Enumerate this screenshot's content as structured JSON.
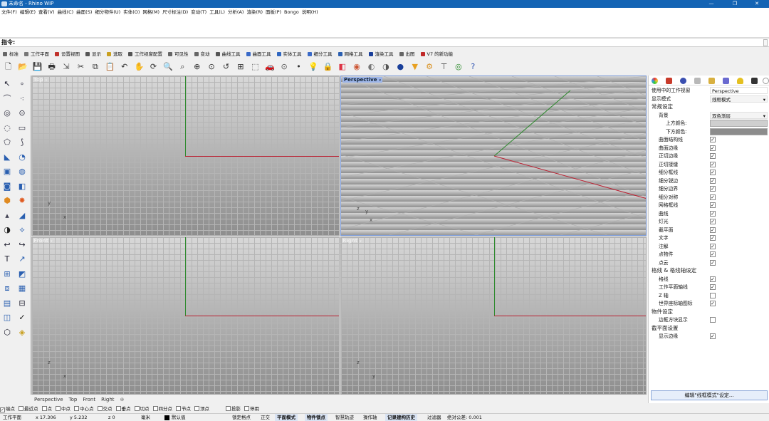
{
  "window": {
    "title": "未命名 - Rhino WIP"
  },
  "menu": [
    "文件(F)",
    "编辑(E)",
    "查看(V)",
    "曲线(C)",
    "曲面(S)",
    "细分物件(U)",
    "实体(O)",
    "网格(M)",
    "尺寸标注(D)",
    "变动(T)",
    "工具(L)",
    "分析(A)",
    "渲染(R)",
    "面板(P)",
    "Bongo",
    "说明(H)"
  ],
  "command": {
    "label": "指令:"
  },
  "tabs": [
    {
      "label": "标准",
      "color": "#666"
    },
    {
      "label": "工作平面",
      "color": "#777"
    },
    {
      "label": "设置视图",
      "color": "#c0302a"
    },
    {
      "label": "显示",
      "color": "#555"
    },
    {
      "label": "选取",
      "color": "#c9a020"
    },
    {
      "label": "工作视窗配置",
      "color": "#555"
    },
    {
      "label": "可见性",
      "color": "#666"
    },
    {
      "label": "变动",
      "color": "#666"
    },
    {
      "label": "曲线工具",
      "color": "#555"
    },
    {
      "label": "曲面工具",
      "color": "#3a6ac8"
    },
    {
      "label": "实体工具",
      "color": "#2f66c0"
    },
    {
      "label": "细分工具",
      "color": "#3a6ac8"
    },
    {
      "label": "网格工具",
      "color": "#2b5fb0"
    },
    {
      "label": "渲染工具",
      "color": "#1a3f9a"
    },
    {
      "label": "出图",
      "color": "#666"
    },
    {
      "label": "V7 的新功能",
      "color": "#c02828"
    }
  ],
  "toolbar_icons": [
    "new-file-icon",
    "open-folder-icon",
    "save-icon",
    "print-icon",
    "import-icon",
    "cut-icon",
    "copy-icon",
    "paste-icon",
    "undo-icon",
    "pan-hand-icon",
    "rotate-view-icon",
    "zoom-icon",
    "zoom-window-icon",
    "zoom-extents-icon",
    "zoom-selected-icon",
    "undo-view-icon",
    "four-viewports-icon",
    "select-icon",
    "car-render-icon",
    "osnap-icon",
    "point-icon",
    "light-bulb-icon",
    "lock-icon",
    "material-icon",
    "color-wheel-icon",
    "shaded-sphere-icon",
    "rendered-sphere-icon",
    "blue-sphere-icon",
    "filter-icon",
    "settings-gear-icon",
    "tree-icon",
    "globe-icon",
    "help-icon"
  ],
  "viewports": {
    "top": "Top",
    "perspective": "Perspective",
    "front": "Front",
    "right": "Right"
  },
  "axes": {
    "x": "x",
    "y": "y",
    "z": "z"
  },
  "viewport_tabs": [
    "Perspective",
    "Top",
    "Front",
    "Right"
  ],
  "osnaps": [
    {
      "label": "端点",
      "checked": true
    },
    {
      "label": "最近点",
      "checked": false
    },
    {
      "label": "点",
      "checked": false
    },
    {
      "label": "中点",
      "checked": false
    },
    {
      "label": "中心点",
      "checked": false
    },
    {
      "label": "交点",
      "checked": false
    },
    {
      "label": "垂点",
      "checked": false
    },
    {
      "label": "切点",
      "checked": false
    },
    {
      "label": "四分点",
      "checked": false
    },
    {
      "label": "节点",
      "checked": false
    },
    {
      "label": "顶点",
      "checked": false
    },
    {
      "label": "投影",
      "checked": false
    },
    {
      "label": "停用",
      "checked": false
    }
  ],
  "status": {
    "cplane": "工作平面",
    "x": "x 17.306",
    "y": "y 5.232",
    "z": "z 0",
    "unit": "毫米",
    "layer": "默认值",
    "grid_snap": "锁定格点",
    "ortho": "正交",
    "planar": "平面模式",
    "osnap": "物件锁点",
    "smarttrack": "智慧轨迹",
    "gumball": "操作轴",
    "history": "记录建构历史",
    "filter": "过滤器",
    "tolerance": "绝对公差: 0.001"
  },
  "panel": {
    "rows": [
      {
        "type": "field",
        "label": "使用中的工作视窗",
        "value": "Perspective"
      },
      {
        "type": "select",
        "label": "显示模式",
        "value": "线框模式"
      },
      {
        "type": "section",
        "label": "常规设定"
      },
      {
        "type": "select",
        "label": "背景",
        "value": "双色渐层",
        "indent": 1
      },
      {
        "type": "color",
        "label": "上方颜色:",
        "color": "#cfcfcf",
        "indent": 2
      },
      {
        "type": "color",
        "label": "下方颜色:",
        "color": "#8c8c8c",
        "indent": 2
      },
      {
        "type": "check",
        "label": "曲面结构线",
        "checked": true,
        "indent": 1
      },
      {
        "type": "check",
        "label": "曲面边缘",
        "checked": true,
        "indent": 1
      },
      {
        "type": "check",
        "label": "正切边缘",
        "checked": true,
        "indent": 1
      },
      {
        "type": "check",
        "label": "正切接缝",
        "checked": true,
        "indent": 1
      },
      {
        "type": "check",
        "label": "细分框线",
        "checked": true,
        "indent": 1
      },
      {
        "type": "check",
        "label": "细分锐边",
        "checked": true,
        "indent": 1
      },
      {
        "type": "check",
        "label": "细分边界",
        "checked": true,
        "indent": 1
      },
      {
        "type": "check",
        "label": "细分对称",
        "checked": true,
        "indent": 1
      },
      {
        "type": "check",
        "label": "网格框线",
        "checked": true,
        "indent": 1
      },
      {
        "type": "check",
        "label": "曲线",
        "checked": true,
        "indent": 1
      },
      {
        "type": "check",
        "label": "灯光",
        "checked": true,
        "indent": 1
      },
      {
        "type": "check",
        "label": "截平面",
        "checked": true,
        "indent": 1
      },
      {
        "type": "check",
        "label": "文字",
        "checked": true,
        "indent": 1
      },
      {
        "type": "check",
        "label": "注解",
        "checked": true,
        "indent": 1
      },
      {
        "type": "check",
        "label": "点物件",
        "checked": true,
        "indent": 1
      },
      {
        "type": "check",
        "label": "点云",
        "checked": true,
        "indent": 1
      },
      {
        "type": "section",
        "label": "格线 & 格线轴设定"
      },
      {
        "type": "check",
        "label": "格线",
        "checked": true,
        "indent": 1
      },
      {
        "type": "check",
        "label": "工作平面轴线",
        "checked": true,
        "indent": 1
      },
      {
        "type": "check",
        "label": "Z 轴",
        "checked": false,
        "indent": 1
      },
      {
        "type": "check",
        "label": "世界座标轴图标",
        "checked": true,
        "indent": 1
      },
      {
        "type": "section",
        "label": "物件设定"
      },
      {
        "type": "check",
        "label": "边框方块显示",
        "checked": false,
        "indent": 1
      },
      {
        "type": "section",
        "label": "截平面设置"
      },
      {
        "type": "check",
        "label": "显示边缘",
        "checked": true,
        "indent": 1
      }
    ],
    "edit_button": "编辑\"线框模式\"设定..."
  }
}
